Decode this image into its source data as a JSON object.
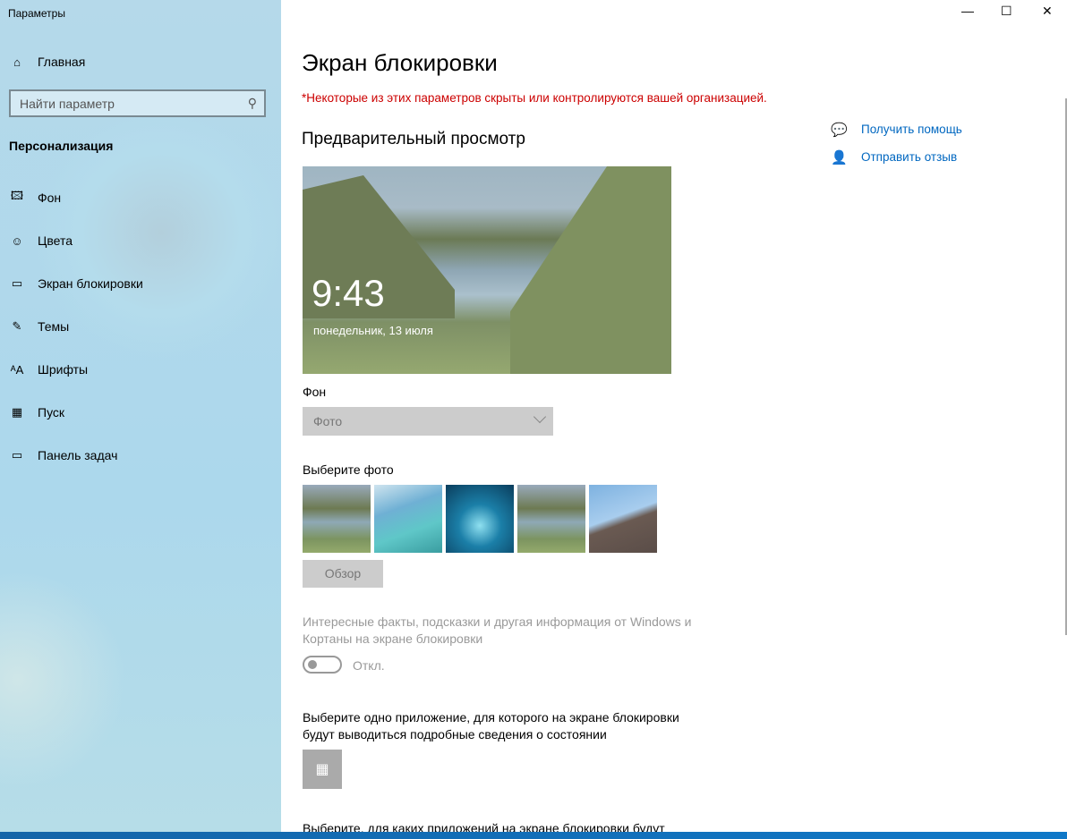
{
  "window": {
    "title": "Параметры",
    "minimize": "—",
    "maximize": "☐",
    "close": "✕"
  },
  "sidebar": {
    "home": "Главная",
    "search_placeholder": "Найти параметр",
    "section": "Персонализация",
    "items": [
      {
        "label": "Фон",
        "icon": "picture-icon"
      },
      {
        "label": "Цвета",
        "icon": "palette-icon"
      },
      {
        "label": "Экран блокировки",
        "icon": "lock-screen-icon"
      },
      {
        "label": "Темы",
        "icon": "themes-icon"
      },
      {
        "label": "Шрифты",
        "icon": "fonts-icon"
      },
      {
        "label": "Пуск",
        "icon": "start-icon"
      },
      {
        "label": "Панель задач",
        "icon": "taskbar-icon"
      }
    ]
  },
  "main": {
    "title": "Экран блокировки",
    "warning": "*Некоторые из этих параметров скрыты или контролируются вашей организацией.",
    "preview_heading": "Предварительный просмотр",
    "preview_time": "9:43",
    "preview_date": "понедельник, 13 июля",
    "background_label": "Фон",
    "background_value": "Фото",
    "choose_photo": "Выберите фото",
    "browse": "Обзор",
    "facts_text": "Интересные факты, подсказки и другая информация от Windows и Кортаны на экране блокировки",
    "toggle_state": "Откл.",
    "app_detail_text": "Выберите одно приложение, для которого на экране блокировки будут выводиться подробные сведения о состоянии",
    "more_text": "Выберите, для каких приложений на экране блокировки будут"
  },
  "links": {
    "help": "Получить помощь",
    "feedback": "Отправить отзыв"
  },
  "colors": {
    "warning": "#cc0000",
    "link": "#0067c0"
  }
}
